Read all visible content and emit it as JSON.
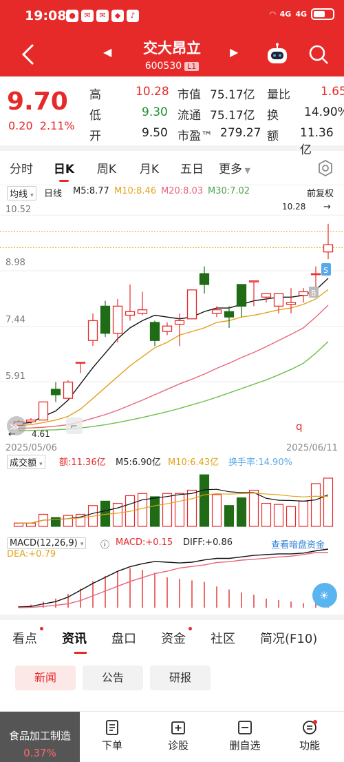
{
  "status": {
    "time": "19:08",
    "signal1": "4G",
    "signal2": "4G"
  },
  "header": {
    "name": "交大昂立",
    "code": "600530",
    "level": "L1"
  },
  "quote": {
    "price": "9.70",
    "change": "0.20",
    "change_pct": "2.11%",
    "high_label": "高",
    "high": "10.28",
    "low_label": "低",
    "low": "9.30",
    "open_label": "开",
    "open": "9.50",
    "mktcap_label": "市值",
    "mktcap": "75.17亿",
    "float_label": "流通",
    "float": "75.17亿",
    "pe_label": "市盈™",
    "pe": "279.27",
    "volratio_label": "量比",
    "volratio": "1.65",
    "turnover_label": "换",
    "turnover": "14.90%",
    "amount_label": "额",
    "amount": "11.36亿"
  },
  "tabs": [
    "分时",
    "日K",
    "周K",
    "月K",
    "五日",
    "更多"
  ],
  "ma": {
    "label_ma": "均线",
    "label_day": "日线",
    "m5": "M5:8.77",
    "m10": "M10:8.46",
    "m20": "M20:8.03",
    "m30": "M30:7.02",
    "fq": "前复权"
  },
  "axis": {
    "y1": "10.52",
    "y2": "8.98",
    "y3": "7.44",
    "y4": "5.91",
    "low_marker": "4.61",
    "high_marker": "10.28",
    "date_start": "2025/05/06",
    "date_end": "2025/06/11",
    "b_marker": "B",
    "s_marker": "S"
  },
  "volume": {
    "label": "成交额",
    "amt": "额:11.36亿",
    "m5": "M5:6.90亿",
    "m10": "M10:6.43亿",
    "turnover": "换手率:14.90%"
  },
  "macd": {
    "label": "MACD(12,26,9)",
    "macd": "MACD:+0.15",
    "diff": "DIFF:+0.86",
    "dea": "DEA:+0.79",
    "link": "查看暗盘资金"
  },
  "colors": {
    "up": "#e62a2a",
    "down": "#1f6b16",
    "ma5": "#111111",
    "ma10": "#e3a11a",
    "ma20": "#e8657a",
    "ma30": "#6cbf4a"
  },
  "subtabs": [
    "看点",
    "资讯",
    "盘口",
    "资金",
    "社区",
    "简况(F10)"
  ],
  "newsbtns": [
    "新闻",
    "公告",
    "研报"
  ],
  "bottom": {
    "sector_name": "食品加工制造",
    "sector_pct": "0.37%",
    "b1": "下单",
    "b2": "诊股",
    "b3": "删自选",
    "b4": "功能"
  },
  "chart_data": {
    "type": "candlestick",
    "y_ticks": [
      10.52,
      8.98,
      7.44,
      5.91
    ],
    "ylim": [
      4.5,
      10.6
    ],
    "dates": [
      "2025/05/06",
      "2025/06/11"
    ],
    "candles": [
      {
        "o": 4.7,
        "c": 4.8,
        "h": 4.85,
        "l": 4.61
      },
      {
        "o": 4.8,
        "c": 4.85,
        "h": 4.9,
        "l": 4.75
      },
      {
        "o": 4.85,
        "c": 5.35,
        "h": 5.35,
        "l": 4.85
      },
      {
        "o": 5.7,
        "c": 5.55,
        "h": 5.9,
        "l": 5.35
      },
      {
        "o": 5.45,
        "c": 5.9,
        "h": 5.95,
        "l": 5.45
      },
      {
        "o": 6.45,
        "c": 6.45,
        "h": 6.45,
        "l": 6.15
      },
      {
        "o": 7.05,
        "c": 7.6,
        "h": 7.8,
        "l": 6.9
      },
      {
        "o": 8.0,
        "c": 7.25,
        "h": 8.15,
        "l": 7.15
      },
      {
        "o": 7.25,
        "c": 8.0,
        "h": 8.2,
        "l": 7.0
      },
      {
        "o": 7.75,
        "c": 7.85,
        "h": 8.6,
        "l": 7.6
      },
      {
        "o": 7.8,
        "c": 7.9,
        "h": 8.4,
        "l": 7.75
      },
      {
        "o": 7.55,
        "c": 7.05,
        "h": 7.6,
        "l": 6.9
      },
      {
        "o": 7.3,
        "c": 7.45,
        "h": 7.55,
        "l": 7.2
      },
      {
        "o": 7.5,
        "c": 7.6,
        "h": 7.8,
        "l": 6.9
      },
      {
        "o": 7.65,
        "c": 8.45,
        "h": 8.45,
        "l": 7.65
      },
      {
        "o": 8.9,
        "c": 8.6,
        "h": 9.1,
        "l": 8.35
      },
      {
        "o": 7.8,
        "c": 7.9,
        "h": 8.0,
        "l": 7.7
      },
      {
        "o": 7.85,
        "c": 7.7,
        "h": 8.0,
        "l": 7.4
      },
      {
        "o": 8.6,
        "c": 8.0,
        "h": 8.6,
        "l": 7.7
      },
      {
        "o": 8.7,
        "c": 8.7,
        "h": 8.7,
        "l": 8.0
      },
      {
        "o": 8.25,
        "c": 8.35,
        "h": 8.35,
        "l": 8.1
      },
      {
        "o": 8.0,
        "c": 8.35,
        "h": 8.35,
        "l": 7.8
      },
      {
        "o": 8.05,
        "c": 8.1,
        "h": 8.5,
        "l": 7.8
      },
      {
        "o": 8.3,
        "c": 8.4,
        "h": 8.5,
        "l": 8.1
      },
      {
        "o": 8.9,
        "c": 8.9,
        "h": 9.1,
        "l": 8.4
      },
      {
        "o": 9.5,
        "c": 9.7,
        "h": 10.28,
        "l": 9.3
      }
    ],
    "ma5": [
      4.75,
      4.78,
      4.95,
      5.1,
      5.4,
      5.85,
      6.3,
      6.7,
      7.1,
      7.4,
      7.6,
      7.75,
      7.7,
      7.65,
      7.7,
      7.85,
      7.95,
      7.95,
      8.05,
      8.15,
      8.2,
      8.25,
      8.25,
      8.3,
      8.45,
      8.77
    ],
    "ma10": [
      4.7,
      4.72,
      4.78,
      4.85,
      4.95,
      5.15,
      5.45,
      5.75,
      6.05,
      6.35,
      6.6,
      6.85,
      7.0,
      7.2,
      7.3,
      7.4,
      7.55,
      7.6,
      7.7,
      7.75,
      7.82,
      7.9,
      7.95,
      8.05,
      8.2,
      8.46
    ],
    "ma20": [
      4.62,
      4.63,
      4.65,
      4.68,
      4.72,
      4.8,
      4.9,
      5.0,
      5.12,
      5.26,
      5.4,
      5.55,
      5.7,
      5.85,
      5.98,
      6.12,
      6.28,
      6.42,
      6.58,
      6.72,
      6.88,
      7.05,
      7.22,
      7.4,
      7.7,
      8.03
    ],
    "ma30": [
      4.55,
      4.56,
      4.57,
      4.58,
      4.6,
      4.63,
      4.67,
      4.72,
      4.78,
      4.85,
      4.92,
      5.0,
      5.08,
      5.17,
      5.27,
      5.37,
      5.48,
      5.6,
      5.72,
      5.84,
      5.96,
      6.1,
      6.25,
      6.42,
      6.7,
      7.02
    ],
    "volume": [
      0.3,
      0.3,
      1.1,
      0.8,
      1.0,
      1.1,
      1.9,
      2.3,
      2.1,
      2.8,
      3.0,
      2.7,
      3.0,
      3.0,
      3.3,
      4.7,
      2.9,
      1.9,
      2.6,
      3.3,
      2.1,
      2.0,
      1.8,
      2.3,
      3.9,
      4.4
    ],
    "macd_hist": [
      0.02,
      0.04,
      0.08,
      0.12,
      0.18,
      0.25,
      0.35,
      0.42,
      0.48,
      0.52,
      0.5,
      0.46,
      0.4,
      0.38,
      0.36,
      0.34,
      0.28,
      0.24,
      0.2,
      0.17,
      0.12,
      0.1,
      0.08,
      0.06,
      0.12,
      0.15
    ]
  }
}
